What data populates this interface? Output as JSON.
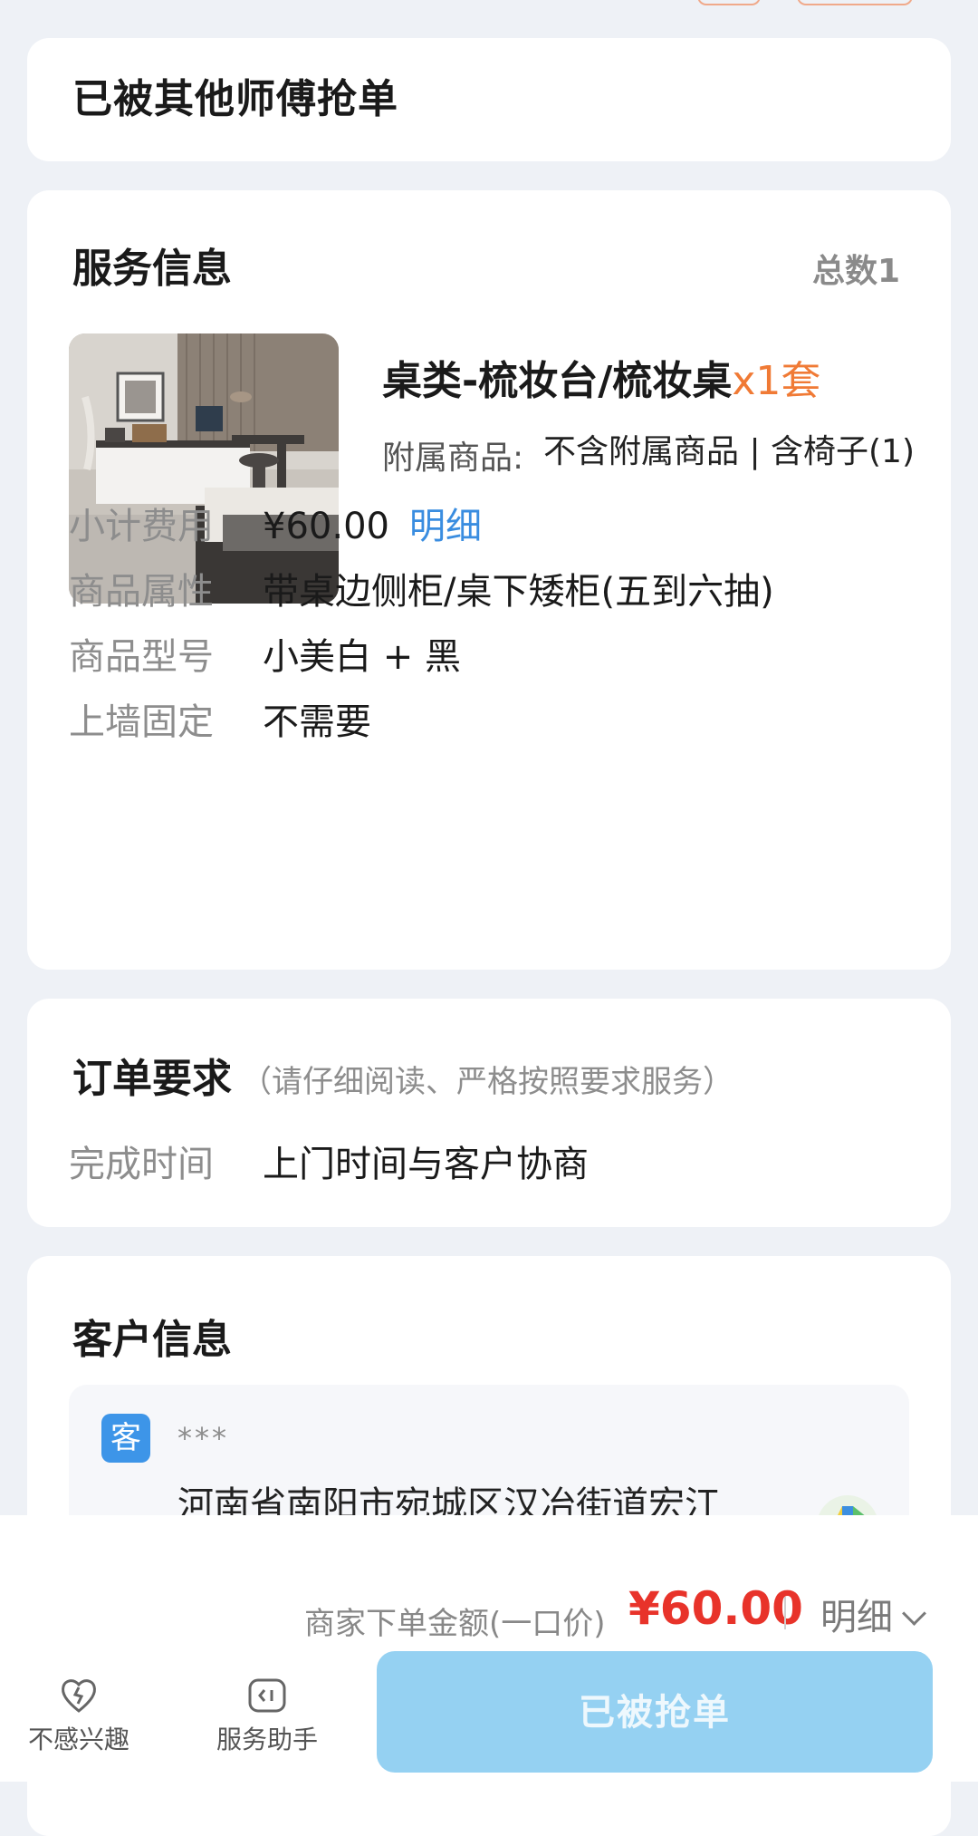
{
  "status": {
    "title": "已被其他师傅抢单"
  },
  "service": {
    "title": "服务信息",
    "total": "总数1",
    "product": {
      "name": "桌类-梳妆台/梳妆桌",
      "qty": "x1套",
      "addon_label": "附属商品:",
      "addon_value": "不含附属商品 | 含椅子(1)"
    },
    "rows": [
      {
        "label": "小计费用",
        "value": "¥60.00",
        "link": "明细"
      },
      {
        "label": "商品属性",
        "value": "带桌边侧柜/桌下矮柜(五到六抽)"
      },
      {
        "label": "商品型号",
        "value": "小美白 + 黑"
      },
      {
        "label": "上墙固定",
        "value": "不需要"
      }
    ]
  },
  "order": {
    "title": "订单要求",
    "note": "（请仔细阅读、严格按照要求服务）",
    "row": {
      "label": "完成时间",
      "value": "上门时间与客户协商"
    }
  },
  "customer": {
    "title": "客户信息",
    "badge": "客",
    "name": "***",
    "address": "河南省南阳市宛城区汉冶街道宏江"
  },
  "bottom": {
    "price_label": "商家下单金额(一口价)",
    "price_value": "¥60.00",
    "detail": "明细",
    "actions": [
      {
        "label": "不感兴趣",
        "icon": "heart-icon"
      },
      {
        "label": "服务助手",
        "icon": "assistant-icon"
      }
    ],
    "button": "已被抢单"
  },
  "colors": {
    "accent": "#3a8de0",
    "price": "#e8332a",
    "qty": "#f07a35",
    "button_disabled": "#95d1f2"
  }
}
